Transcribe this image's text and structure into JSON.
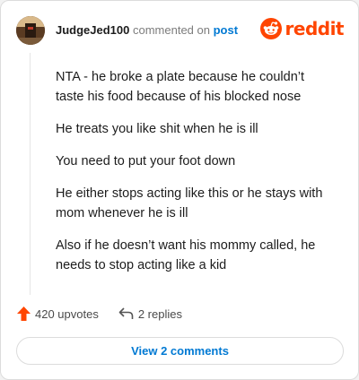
{
  "header": {
    "username": "JudgeJed100",
    "action_text": " commented on ",
    "target_text": "post"
  },
  "brand": {
    "wordmark": "reddit",
    "logo_icon": "reddit-alien-icon",
    "color": "#ff4500"
  },
  "comment": {
    "paragraphs": [
      "NTA - he broke a plate because he couldn’t taste his food because of his blocked nose",
      "He treats you like shit when he is ill",
      "You need to put your foot down",
      "He either stops acting like this or he stays with mom whenever he is ill",
      "Also if he doesn’t want his mommy called, he needs to stop acting like a kid"
    ]
  },
  "actions": {
    "upvotes_label": "420 upvotes",
    "upvote_icon": "upvote-arrow-icon",
    "replies_label": "2 replies",
    "reply_icon": "reply-arrow-icon"
  },
  "view_comments": {
    "label": "View 2 comments"
  },
  "colors": {
    "link": "#0079d3",
    "upvote": "#ff4500",
    "text": "#1c1c1c",
    "muted": "#7c7c7c"
  }
}
